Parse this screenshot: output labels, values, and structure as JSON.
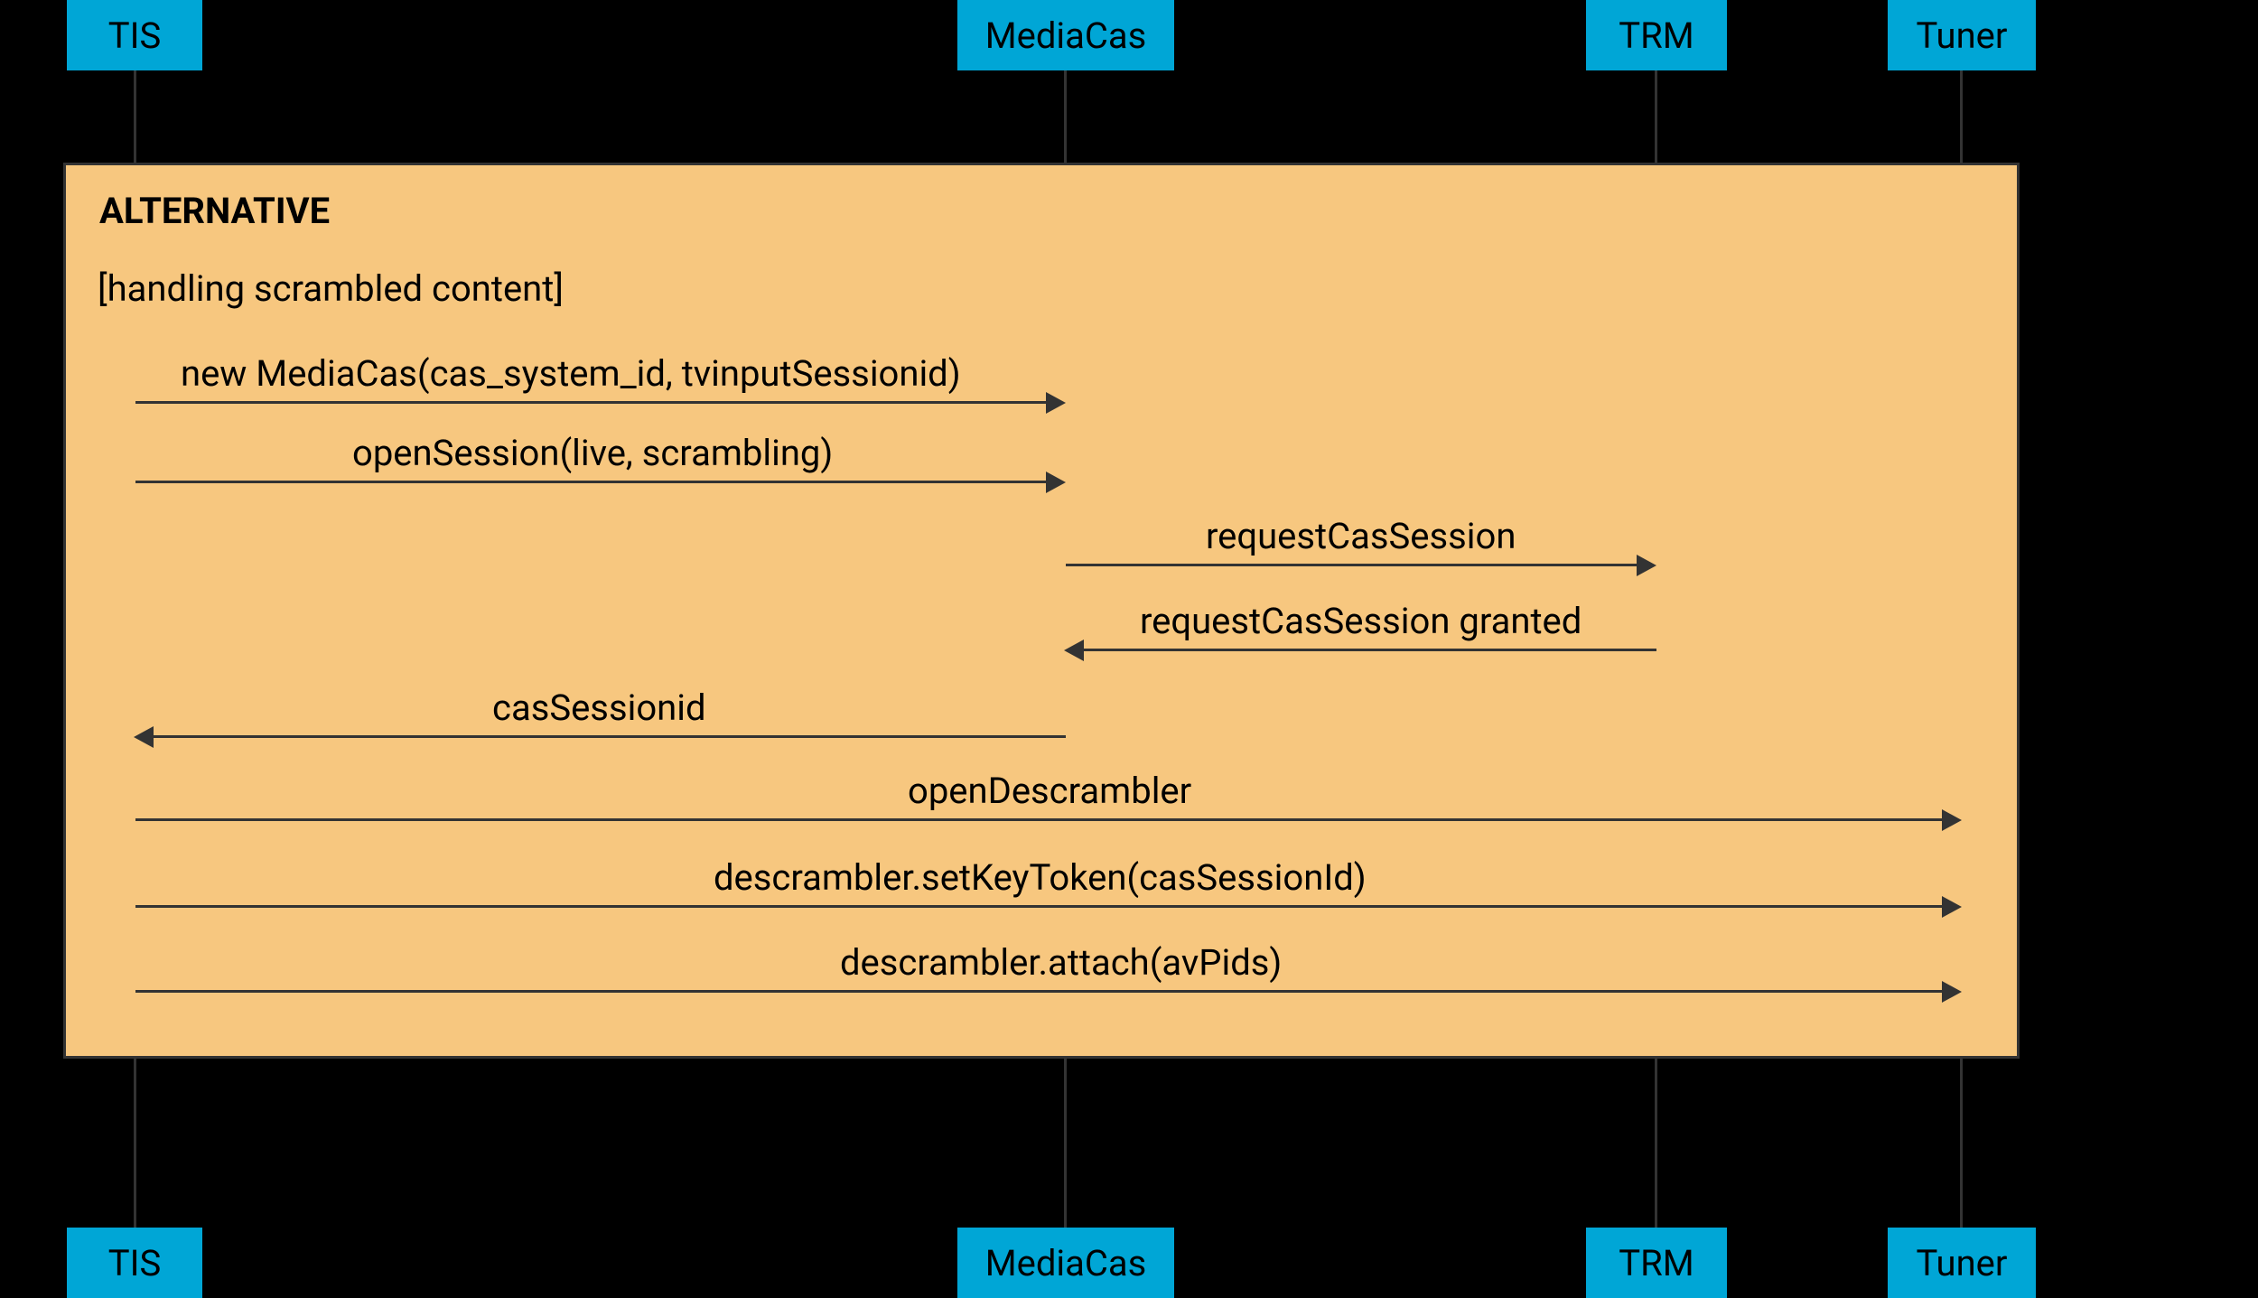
{
  "participants": {
    "tis": "TIS",
    "mediacas": "MediaCas",
    "trm": "TRM",
    "tuner": "Tuner"
  },
  "fragment": {
    "label": "ALTERNATIVE",
    "guard": "[handling scrambled content]"
  },
  "messages": {
    "m1": "new MediaCas(cas_system_id, tvinputSessionid)",
    "m2": "openSession(live, scrambling)",
    "m3": "requestCasSession",
    "m4": "requestCasSession granted",
    "m5": "casSessionid",
    "m6": "openDescrambler",
    "m7": "descrambler.setKeyToken(casSessionId)",
    "m8": "descrambler.attach(avPids)"
  }
}
